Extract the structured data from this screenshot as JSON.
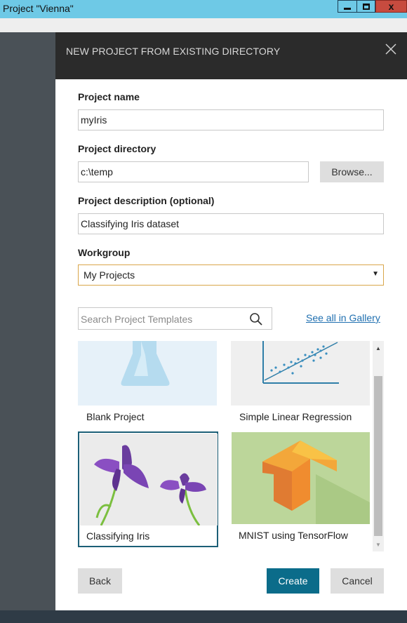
{
  "window": {
    "title": "Project \"Vienna\"",
    "close_glyph": "x"
  },
  "dialog": {
    "title": "NEW PROJECT FROM EXISTING DIRECTORY",
    "project_name": {
      "label": "Project name",
      "value": "myIris"
    },
    "project_directory": {
      "label": "Project directory",
      "value": "c:\\temp",
      "browse_label": "Browse..."
    },
    "project_description": {
      "label": "Project description (optional)",
      "value": "Classifying Iris dataset"
    },
    "workgroup": {
      "label": "Workgroup",
      "selected": "My Projects"
    },
    "search": {
      "placeholder": "Search Project Templates"
    },
    "gallery_link": "See all in Gallery",
    "templates": [
      {
        "label": "Blank Project",
        "selected": false
      },
      {
        "label": "Simple Linear Regression",
        "selected": false
      },
      {
        "label": "Classifying Iris",
        "selected": true
      },
      {
        "label": "MNIST using TensorFlow",
        "selected": false
      }
    ],
    "buttons": {
      "back": "Back",
      "create": "Create",
      "cancel": "Cancel"
    }
  },
  "colors": {
    "titlebar": "#6ec9e6",
    "dialog_header": "#2b2b2b",
    "primary_button": "#0b6c8a",
    "selected_tile_border": "#1c5f77",
    "link": "#1f6fb0",
    "workgroup_focus_border": "#d9a64a"
  },
  "icons": [
    "minimize-icon",
    "maximize-icon",
    "close-icon",
    "search-icon",
    "dropdown-arrow-icon",
    "scroll-up-icon",
    "scroll-down-icon"
  ]
}
